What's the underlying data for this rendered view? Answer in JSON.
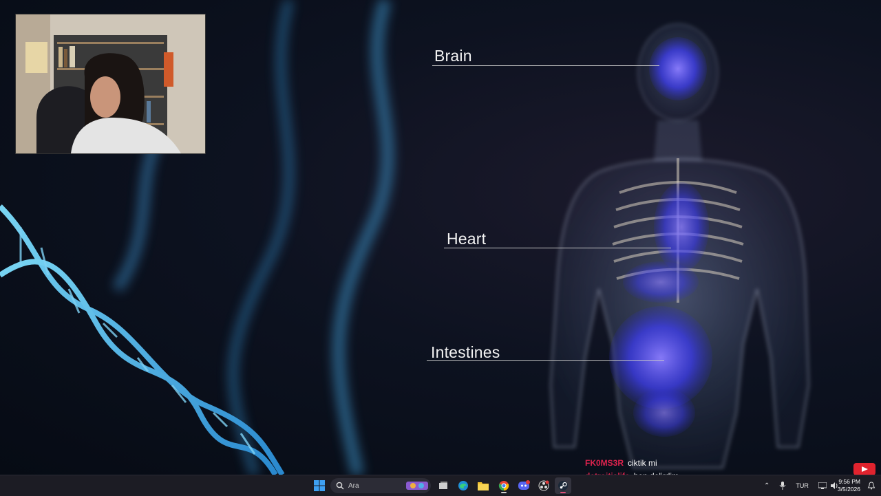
{
  "scene": {
    "labels": [
      {
        "name": "brain",
        "text": "Brain"
      },
      {
        "name": "heart",
        "text": "Heart"
      },
      {
        "name": "intestines",
        "text": "Intestines"
      }
    ]
  },
  "chat": {
    "messages": [
      {
        "user": "FK0MS3R",
        "text": "ciktik mi"
      },
      {
        "user": "detroitislife",
        "text": "ben delirdim"
      }
    ]
  },
  "taskbar": {
    "search_placeholder": "Ara",
    "apps": [
      "widgets",
      "task-view",
      "edge",
      "file-explorer",
      "chrome",
      "discord",
      "obs",
      "steam"
    ],
    "tray": {
      "language": "TUR",
      "time": "9:56 PM",
      "date": "3/5/2026"
    }
  },
  "colors": {
    "accent_blue": "#3a8cff",
    "chat_user": "#e0234e",
    "taskbar_bg": "#1c1c24"
  }
}
